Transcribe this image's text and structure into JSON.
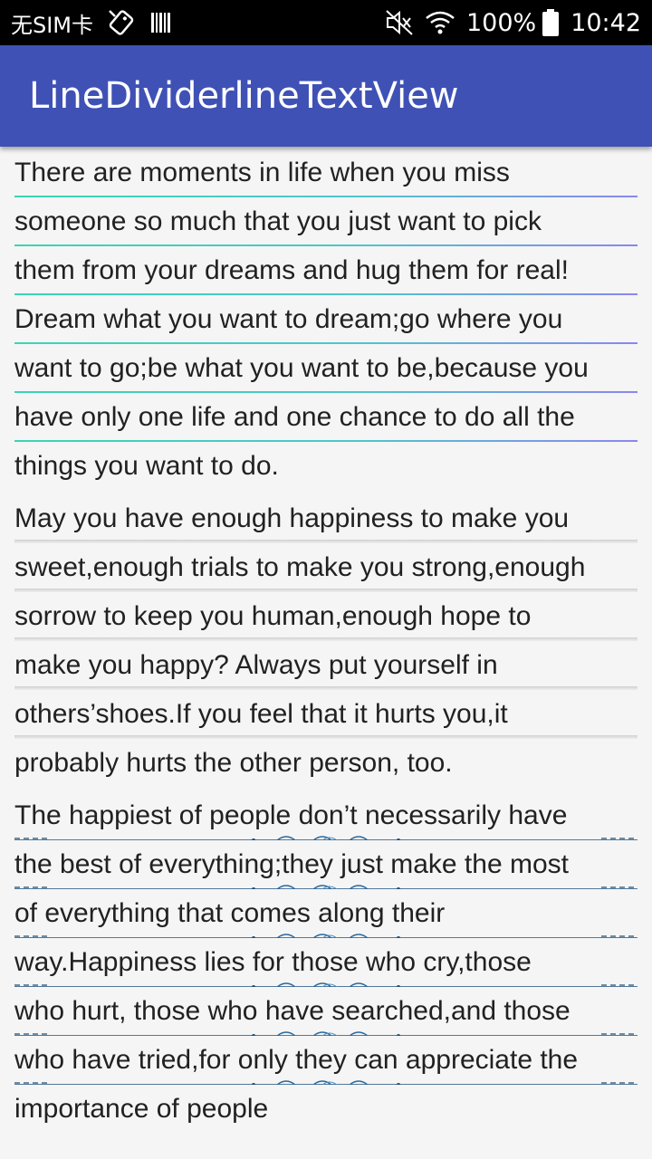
{
  "status_bar": {
    "carrier": "无SIM卡",
    "battery": "100%",
    "time": "10:42",
    "icons": [
      "no-sim-tag-icon",
      "barcode-icon",
      "mute-icon",
      "wifi-icon",
      "battery-icon"
    ]
  },
  "app_bar": {
    "title": "LineDividerlineTextView",
    "color": "#3f51b5"
  },
  "paragraphs": [
    {
      "style": "gradient-line",
      "lines": [
        "There are moments in life when you miss",
        "someone so much that you just want to pick",
        "them from your dreams and hug them for real!",
        "Dream what you want to dream;go where you",
        "want to go;be what you want to be,because you",
        "have only one life and one chance to do all the",
        "things you want to do."
      ]
    },
    {
      "style": "shadow-line",
      "lines": [
        "May you have enough happiness to make you",
        "sweet,enough trials to make you strong,enough",
        "sorrow to keep you human,enough hope to",
        "make you happy? Always put yourself in",
        "others’shoes.If you feel that it hurts you,it",
        "probably hurts the other person, too."
      ]
    },
    {
      "style": "ornament-line",
      "lines": [
        "The happiest of people don’t necessarily have",
        "the best of everything;they just make the most",
        "of everything that comes along their",
        "way.Happiness lies for those who cry,those",
        "who hurt, those who have searched,and those",
        "who have tried,for only they can appreciate the",
        "importance of people"
      ]
    }
  ]
}
